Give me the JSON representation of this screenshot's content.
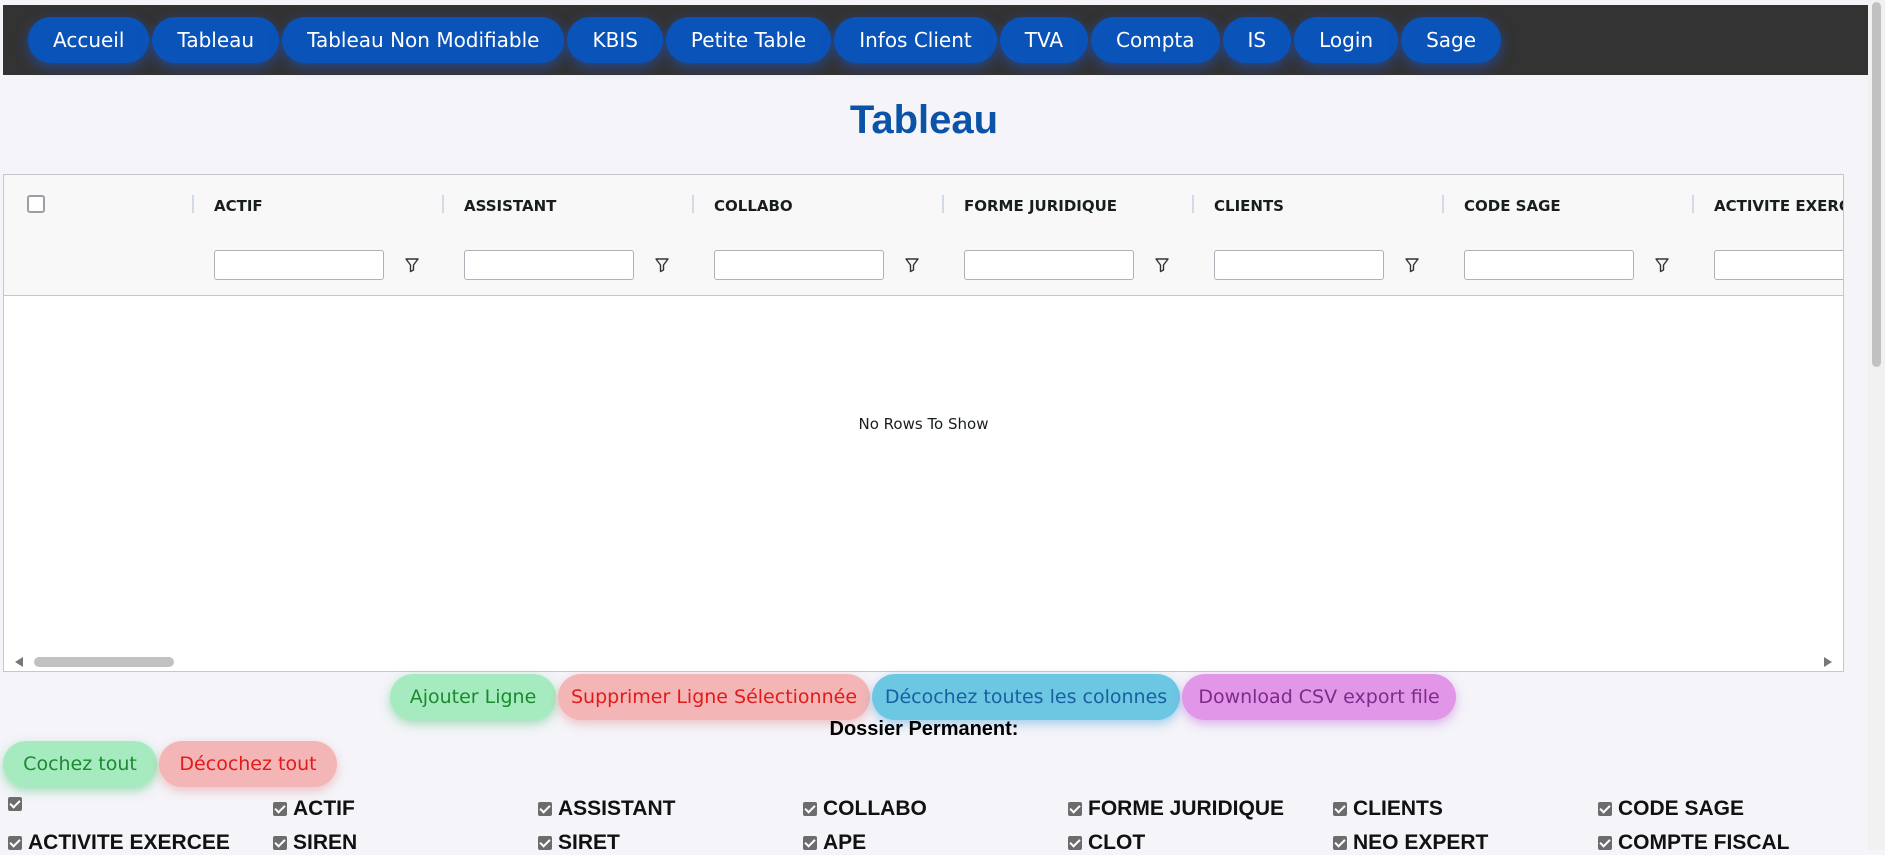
{
  "nav": {
    "items": [
      "Accueil",
      "Tableau",
      "Tableau Non Modifiable",
      "KBIS",
      "Petite Table",
      "Infos Client",
      "TVA",
      "Compta",
      "IS",
      "Login",
      "Sage"
    ]
  },
  "page_title": "Tableau",
  "grid": {
    "columns": [
      "ACTIF",
      "ASSISTANT",
      "COLLABO",
      "FORME JURIDIQUE",
      "CLIENTS",
      "CODE SAGE",
      "ACTIVITE EXERCE"
    ],
    "empty_message": "No Rows To Show"
  },
  "actions": {
    "add_row": "Ajouter Ligne",
    "delete_row": "Supprimer Ligne Sélectionnée",
    "uncheck_columns": "Décochez toutes les colonnes",
    "download_csv": "Download CSV export file"
  },
  "permanent": {
    "title": "Dossier Permanent:",
    "check_all": "Cochez tout",
    "uncheck_all": "Décochez tout",
    "columns": [
      "",
      "ACTIF",
      "ASSISTANT",
      "COLLABO",
      "FORME JURIDIQUE",
      "CLIENTS",
      "CODE SAGE",
      "ACTIVITE EXERCEE",
      "SIREN",
      "SIRET",
      "APE",
      "CLOT",
      "NEO EXPERT",
      "COMPTE FISCAL"
    ]
  }
}
